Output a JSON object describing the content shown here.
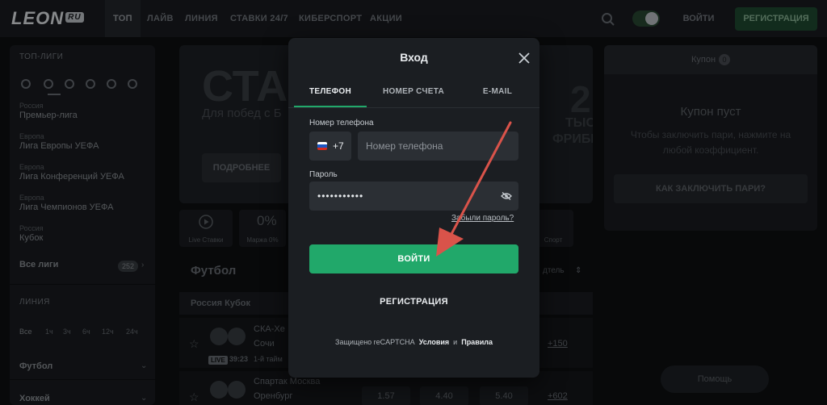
{
  "colors": {
    "accent": "#21a86a",
    "annotation_arrow": "#d9534a"
  },
  "nav": {
    "logo": "LEON",
    "logo_badge": "RU",
    "items": [
      "ТОП",
      "ЛАЙВ",
      "ЛИНИЯ",
      "СТАВКИ 24/7",
      "КИБЕРСПОРТ",
      "АКЦИИ"
    ],
    "login": "ВОЙТИ",
    "register": "РЕГИСТРАЦИЯ",
    "icons": [
      "search-icon",
      "theme-toggle"
    ]
  },
  "sidebar": {
    "top_leagues_title": "ТОП-ЛИГИ",
    "leagues": [
      {
        "country": "Россия",
        "name": "Премьер-лига"
      },
      {
        "country": "Европа",
        "name": "Лига Европы УЕФА"
      },
      {
        "country": "Европа",
        "name": "Лига Конференций УЕФА"
      },
      {
        "country": "Европа",
        "name": "Лига Чемпионов УЕФА"
      },
      {
        "country": "Россия",
        "name": "Кубок"
      }
    ],
    "all_leagues": "Все лиги",
    "all_leagues_count": "252",
    "line_title": "ЛИНИЯ",
    "time_filters": [
      "Все",
      "1ч",
      "3ч",
      "6ч",
      "12ч",
      "24ч"
    ],
    "sports": [
      "Футбол",
      "Хоккей"
    ]
  },
  "main": {
    "banner_title": "СТАР",
    "banner_subtitle": "Для побед с Б",
    "banner_button": "ПОДРОБНЕЕ",
    "banner_big": "2",
    "banner_txt_a": "ТЫС",
    "banner_txt_b": "ФРИБЕ",
    "quick_links": [
      "Live Ставки",
      "Маржа 0%",
      "Спорт"
    ],
    "sport_heading": "Футбол",
    "sort_label": "дтель",
    "tournament": "Россия Кубок",
    "matches": [
      {
        "home": "СКА-Хе",
        "away": "Сочи",
        "live": "LIVE",
        "time": "39:23",
        "extra": "1-й тайм",
        "more": "+150"
      },
      {
        "home": "Спартак Москва",
        "away": "Оренбург",
        "odds": [
          "1.57",
          "4.40",
          "5.40"
        ],
        "more": "+602"
      }
    ]
  },
  "coupon": {
    "tab": "Купон",
    "count": "0",
    "empty_title": "Купон пуст",
    "empty_desc": "Чтобы заключить пари, нажмите на любой коэффициент.",
    "how_button": "КАК ЗАКЛЮЧИТЬ ПАРИ?",
    "help": "Помощь"
  },
  "modal": {
    "title": "Вход",
    "tabs": [
      "ТЕЛЕФОН",
      "НОМЕР СЧЕТА",
      "E-MAIL"
    ],
    "active_tab": "ТЕЛЕФОН",
    "phone_label": "Номер телефона",
    "dial_code": "+7",
    "phone_placeholder": "Номер телефона",
    "password_label": "Пароль",
    "password_value": "•••••••••••",
    "forgot": "Забыли пароль?",
    "submit": "ВОЙТИ",
    "register": "РЕГИСТРАЦИЯ",
    "captcha_prefix": "Защищено reCAPTCHA",
    "terms": "Условия",
    "and": "и",
    "rules": "Правила"
  }
}
